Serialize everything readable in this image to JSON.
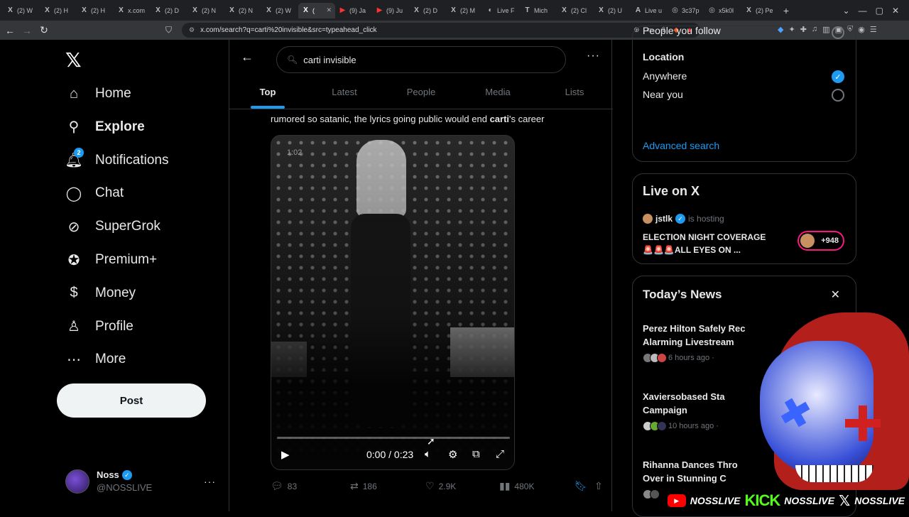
{
  "browser": {
    "tabs": [
      {
        "icon": "X",
        "label": "(2) W",
        "active": false
      },
      {
        "icon": "X",
        "label": "(2) H",
        "active": false
      },
      {
        "icon": "X",
        "label": "(2) H",
        "active": false
      },
      {
        "icon": "X",
        "label": "x.com",
        "active": false
      },
      {
        "icon": "X",
        "label": "(2) D",
        "active": false
      },
      {
        "icon": "X",
        "label": "(2) N",
        "active": false
      },
      {
        "icon": "X",
        "label": "(2) N",
        "active": false
      },
      {
        "icon": "X",
        "label": "(2) W",
        "active": false
      },
      {
        "icon": "X",
        "label": "(",
        "active": true
      },
      {
        "icon": "▶",
        "label": "(9) Ja",
        "active": false,
        "red": true
      },
      {
        "icon": "▶",
        "label": "(9) Ju",
        "active": false,
        "red": true
      },
      {
        "icon": "X",
        "label": "(2) D",
        "active": false
      },
      {
        "icon": "X",
        "label": "(2) M",
        "active": false
      },
      {
        "icon": "◐",
        "label": "Live F",
        "active": false
      },
      {
        "icon": "T",
        "label": "Mich",
        "active": false
      },
      {
        "icon": "X",
        "label": "(2) Cl",
        "active": false
      },
      {
        "icon": "X",
        "label": "(2) U",
        "active": false
      },
      {
        "icon": "A",
        "label": "Live u",
        "active": false
      },
      {
        "icon": "◎",
        "label": "3c37p",
        "active": false
      },
      {
        "icon": "◎",
        "label": "x5k0l",
        "active": false
      },
      {
        "icon": "X",
        "label": "(2) Pe",
        "active": false
      }
    ],
    "url": "x.com/search?q=carti%20invisible&src=typeahead_click"
  },
  "nav": {
    "items": [
      {
        "label": "Home",
        "icon": "home-icon"
      },
      {
        "label": "Explore",
        "icon": "search-icon"
      },
      {
        "label": "Notifications",
        "icon": "bell-icon",
        "badge": "2"
      },
      {
        "label": "Chat",
        "icon": "chat-icon"
      },
      {
        "label": "SuperGrok",
        "icon": "grok-icon"
      },
      {
        "label": "Premium+",
        "icon": "premium-icon"
      },
      {
        "label": "Money",
        "icon": "money-icon"
      },
      {
        "label": "Profile",
        "icon": "profile-icon"
      },
      {
        "label": "More",
        "icon": "more-icon"
      }
    ],
    "post_label": "Post",
    "account": {
      "name": "Noss",
      "handle": "@NOSSLIVE"
    }
  },
  "search": {
    "query": "carti invisible",
    "tabs": [
      "Top",
      "Latest",
      "People",
      "Media",
      "Lists"
    ]
  },
  "tweet": {
    "text_before": "rumored so satanic, the lyrics going public would end ",
    "text_bold": "carti",
    "text_after": "'s career",
    "video": {
      "overlay_time": "1:02",
      "time": "0:00 / 0:23",
      "progress": 0
    },
    "stats": {
      "replies": "83",
      "reposts": "186",
      "likes": "2.9K",
      "views": "480K"
    }
  },
  "filters": {
    "people_label": "People you follow",
    "location_heading": "Location",
    "anywhere_label": "Anywhere",
    "near_label": "Near you",
    "advanced_label": "Advanced search"
  },
  "live": {
    "title": "Live on X",
    "host": "jstlk",
    "hosting_text": "is hosting",
    "line1": "ELECTION NIGHT COVERAGE",
    "line2": "🚨🚨🚨ALL EYES ON ...",
    "count": "+948"
  },
  "news": {
    "title": "Today’s News",
    "items": [
      {
        "line1": "Perez Hilton Safely Rec",
        "line2": "Alarming Livestream",
        "time": "6 hours ago ·"
      },
      {
        "line1": "Xaviersobased Sta",
        "line2": "Campaign",
        "time": "10 hours ago ·"
      },
      {
        "line1": "Rihanna Dances Thro",
        "line2": "Over in Stunning C",
        "time": ""
      }
    ]
  },
  "stream_overlay": {
    "youtube_name": "NOSSLIVE",
    "kick_label": "KICK",
    "kick_name": "NOSSLIVE",
    "x_name": "NOSSLIVE"
  },
  "colors": {
    "accent": "#1d9bf0",
    "background": "#000000",
    "border": "#2f3336"
  }
}
